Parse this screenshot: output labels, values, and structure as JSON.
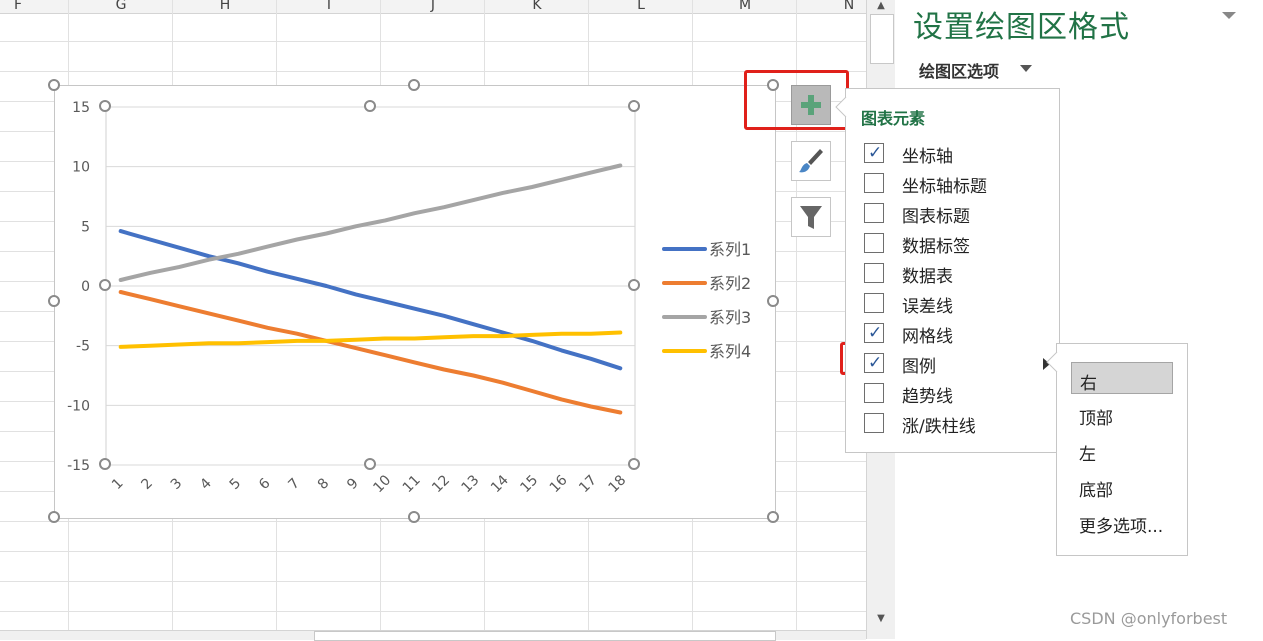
{
  "sheet": {
    "columns": [
      "F",
      "G",
      "H",
      "I",
      "J",
      "K",
      "L",
      "M",
      "N"
    ]
  },
  "pane": {
    "title": "设置绘图区格式",
    "tab_label": "绘图区选项"
  },
  "chart_buttons": {
    "add": "chart-elements",
    "style": "chart-styles",
    "filter": "chart-filters"
  },
  "elements_menu": {
    "title": "图表元素",
    "items": [
      {
        "label": "坐标轴",
        "checked": true
      },
      {
        "label": "坐标轴标题",
        "checked": false
      },
      {
        "label": "图表标题",
        "checked": false
      },
      {
        "label": "数据标签",
        "checked": false
      },
      {
        "label": "数据表",
        "checked": false
      },
      {
        "label": "误差线",
        "checked": false
      },
      {
        "label": "网格线",
        "checked": true
      },
      {
        "label": "图例",
        "checked": true,
        "has_submenu": true
      },
      {
        "label": "趋势线",
        "checked": false
      },
      {
        "label": "涨/跌柱线",
        "checked": false
      }
    ],
    "check_glyph": "✓"
  },
  "legend_submenu": {
    "items": [
      "右",
      "顶部",
      "左",
      "底部",
      "更多选项..."
    ],
    "selected": "右"
  },
  "watermark": "CSDN @onlyforbest",
  "chart_data": {
    "type": "line",
    "x": [
      "1",
      "2",
      "3",
      "4",
      "5",
      "6",
      "7",
      "8",
      "9",
      "10",
      "11",
      "12",
      "13",
      "14",
      "15",
      "16",
      "17",
      "18"
    ],
    "ylim": [
      -15,
      15
    ],
    "yticks": [
      15,
      10,
      5,
      0,
      -5,
      -10,
      -15
    ],
    "grid": true,
    "legend_position": "right",
    "series": [
      {
        "name": "系列1",
        "color": "#4472c4",
        "values": [
          4.6,
          3.9,
          3.2,
          2.5,
          1.9,
          1.2,
          0.6,
          0.0,
          -0.7,
          -1.3,
          -1.9,
          -2.5,
          -3.2,
          -3.9,
          -4.6,
          -5.4,
          -6.1,
          -6.9
        ]
      },
      {
        "name": "系列2",
        "color": "#ed7d31",
        "values": [
          -0.5,
          -1.1,
          -1.7,
          -2.3,
          -2.9,
          -3.5,
          -4.0,
          -4.6,
          -5.2,
          -5.8,
          -6.4,
          -7.0,
          -7.5,
          -8.1,
          -8.8,
          -9.5,
          -10.1,
          -10.6
        ]
      },
      {
        "name": "系列3",
        "color": "#a5a5a5",
        "values": [
          0.5,
          1.1,
          1.6,
          2.2,
          2.7,
          3.3,
          3.9,
          4.4,
          5.0,
          5.5,
          6.1,
          6.6,
          7.2,
          7.8,
          8.3,
          8.9,
          9.5,
          10.1
        ]
      },
      {
        "name": "系列4",
        "color": "#ffc000",
        "values": [
          -5.1,
          -5.0,
          -4.9,
          -4.8,
          -4.8,
          -4.7,
          -4.6,
          -4.6,
          -4.5,
          -4.4,
          -4.4,
          -4.3,
          -4.2,
          -4.2,
          -4.1,
          -4.0,
          -4.0,
          -3.9
        ]
      }
    ]
  }
}
